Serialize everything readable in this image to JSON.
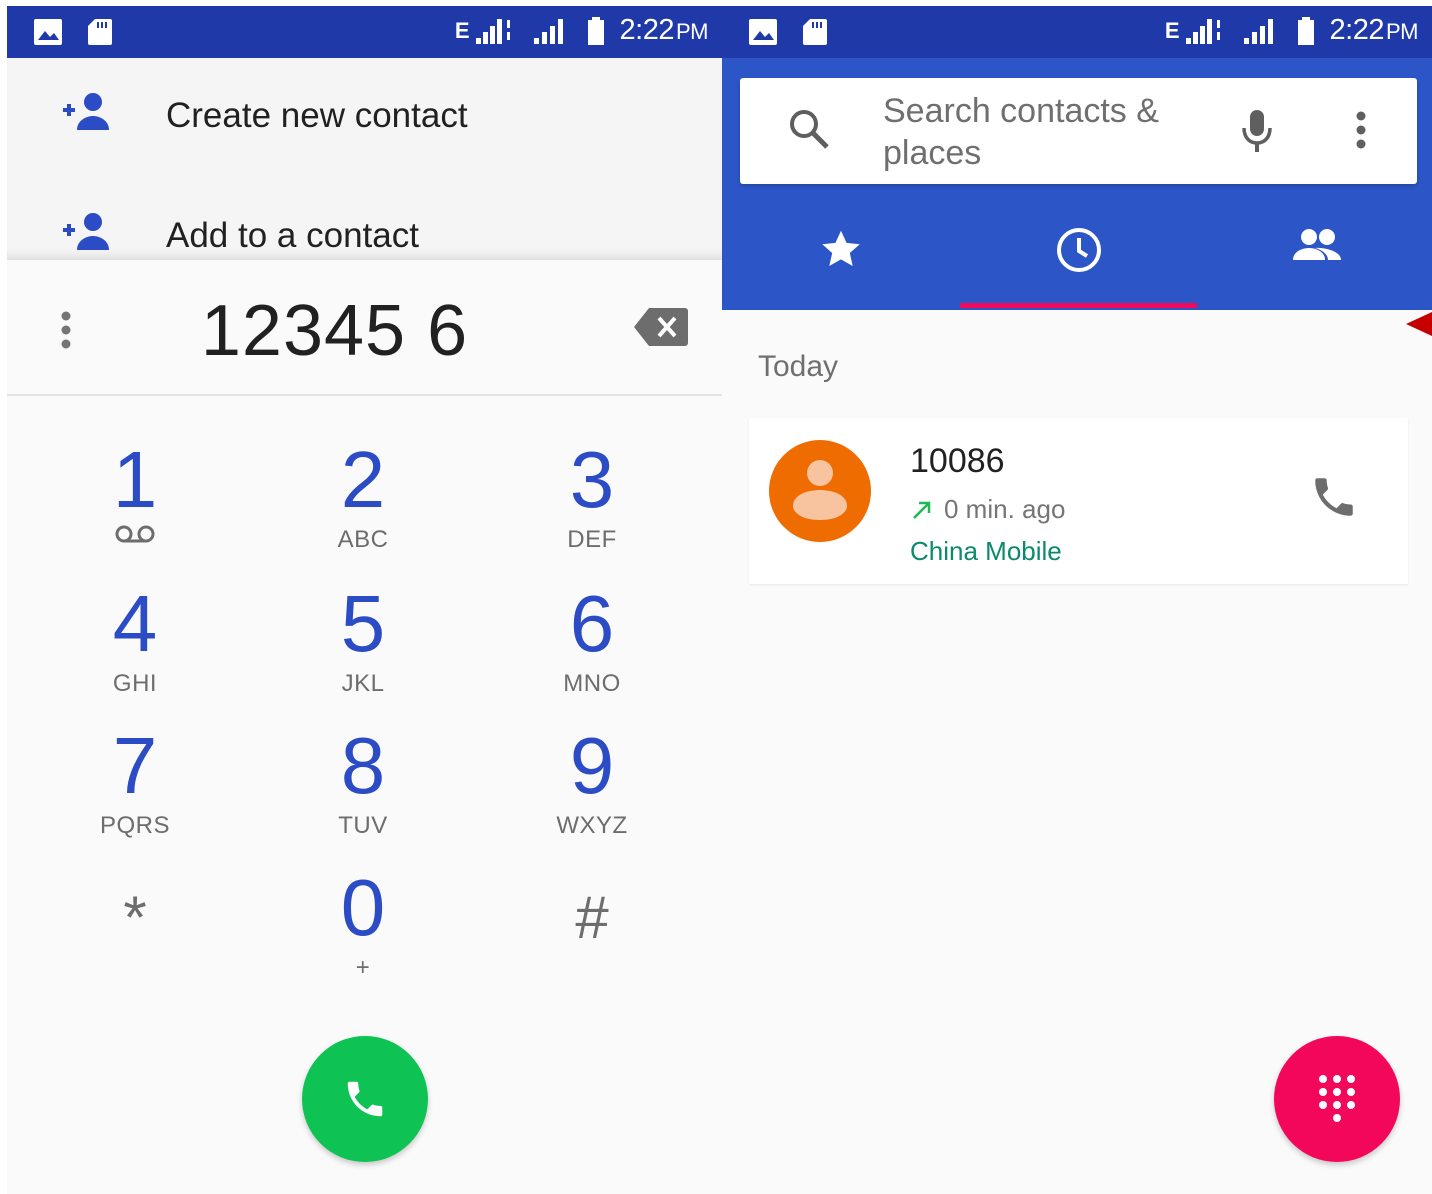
{
  "left": {
    "status": {
      "network": "E",
      "time": "2:22",
      "ampm": "PM"
    },
    "suggestions": [
      {
        "label": "Create new contact",
        "icon": "add-person-icon"
      },
      {
        "label": "Add to a contact",
        "icon": "add-person-icon"
      }
    ],
    "digits": "12345 6",
    "keypad": [
      {
        "num": "1",
        "sub": "",
        "icon": "voicemail-icon"
      },
      {
        "num": "2",
        "sub": "ABC"
      },
      {
        "num": "3",
        "sub": "DEF"
      },
      {
        "num": "4",
        "sub": "GHI"
      },
      {
        "num": "5",
        "sub": "JKL"
      },
      {
        "num": "6",
        "sub": "MNO"
      },
      {
        "num": "7",
        "sub": "PQRS"
      },
      {
        "num": "8",
        "sub": "TUV"
      },
      {
        "num": "9",
        "sub": "WXYZ"
      },
      {
        "num": "*",
        "sub": ""
      },
      {
        "num": "0",
        "sub": "+"
      },
      {
        "num": "#",
        "sub": ""
      }
    ],
    "call_button_color": "#0ec253"
  },
  "right": {
    "status": {
      "network": "E",
      "time": "2:22",
      "ampm": "PM"
    },
    "search": {
      "placeholder": "Search contacts & places"
    },
    "tabs": [
      {
        "name": "speed-dial",
        "icon": "star-icon"
      },
      {
        "name": "recents",
        "icon": "clock-icon",
        "selected": true
      },
      {
        "name": "contacts",
        "icon": "people-icon"
      }
    ],
    "section_label": "Today",
    "calls": [
      {
        "number": "10086",
        "direction": "outgoing",
        "time": "0 min. ago",
        "carrier": "China Mobile"
      }
    ],
    "accent": "#f3075a",
    "header_color": "#2c56c8"
  }
}
